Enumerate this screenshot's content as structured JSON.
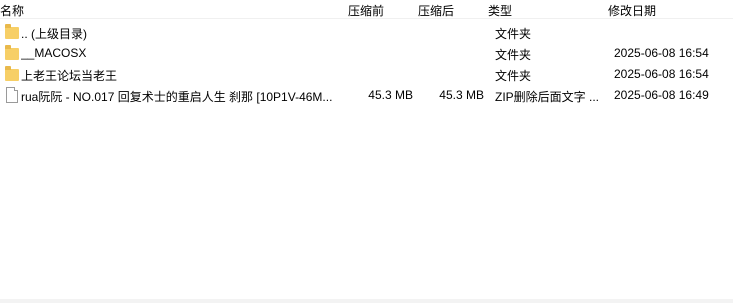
{
  "header": {
    "name": "名称",
    "compressed_size": "压缩前",
    "packed_size": "压缩后",
    "type": "类型",
    "modified": "修改日期"
  },
  "rows": [
    {
      "icon": "folder-icon",
      "name": ".. (上级目录)",
      "size": "",
      "packed": "",
      "type": "文件夹",
      "date": ""
    },
    {
      "icon": "folder-icon",
      "name": "__MACOSX",
      "size": "",
      "packed": "",
      "type": "文件夹",
      "date": "2025-06-08 16:54"
    },
    {
      "icon": "folder-icon",
      "name": "上老王论坛当老王",
      "size": "",
      "packed": "",
      "type": "文件夹",
      "date": "2025-06-08 16:54"
    },
    {
      "icon": "file-icon",
      "name": "rua阮阮 - NO.017 回复术士的重启人生 刹那 [10P1V-46M...",
      "size": "45.3 MB",
      "packed": "45.3 MB",
      "type": "ZIP删除后面文字 ...",
      "date": "2025-06-08 16:49"
    }
  ]
}
